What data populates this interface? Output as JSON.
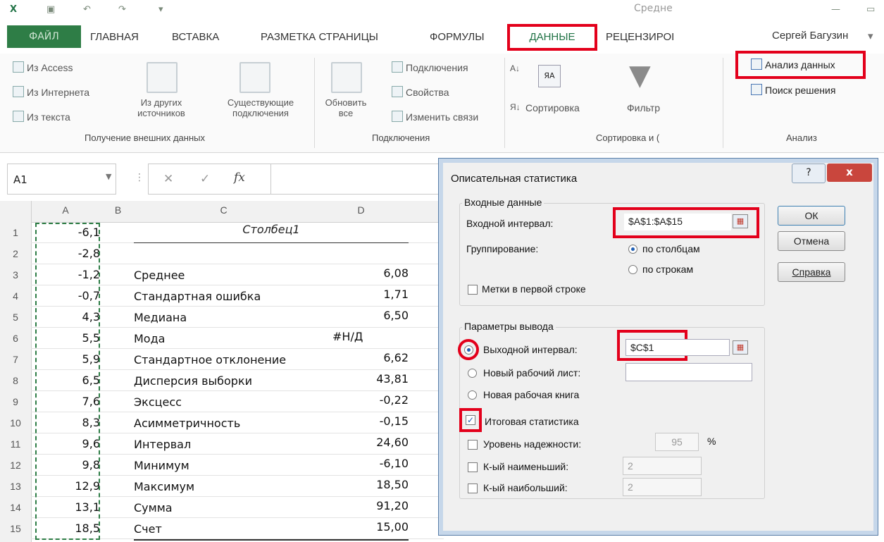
{
  "ribbon": {
    "tabs": [
      "ФАЙЛ",
      "ГЛАВНАЯ",
      "ВСТАВКА",
      "РАЗМЕТКА СТРАНИЦЫ",
      "ФОРМУЛЫ",
      "ДАННЫЕ",
      "РЕЦЕНЗИРОІ"
    ],
    "user": "Сергей Багузин",
    "title_fragment": "Средне",
    "ext_data": {
      "from_access": "Из Access",
      "from_web": "Из Интернета",
      "from_text": "Из текста",
      "other_sources_1": "Из других",
      "other_sources_2": "источников",
      "existing_1": "Существующие",
      "existing_2": "подключения",
      "group": "Получение внешних данных"
    },
    "connections": {
      "refresh_1": "Обновить",
      "refresh_2": "все",
      "connections": "Подключения",
      "properties": "Свойства",
      "edit_links": "Изменить связи",
      "group": "Подключения"
    },
    "sort": {
      "sort": "Сортировка",
      "filter": "Фильтр",
      "group": "Сортировка и ("
    },
    "analysis": {
      "data_analysis": "Анализ данных",
      "solver": "Поиск решения",
      "group": "Анализ"
    }
  },
  "formula_bar": {
    "name_box": "A1",
    "fx": "fx"
  },
  "sheet": {
    "col_headers": [
      "A",
      "B",
      "C",
      "D"
    ],
    "row_numbers": [
      "1",
      "2",
      "3",
      "4",
      "5",
      "6",
      "7",
      "8",
      "9",
      "10",
      "11",
      "12",
      "13",
      "14",
      "15"
    ],
    "colA": [
      "-6,1",
      "-2,8",
      "-1,2",
      "-0,7",
      "4,3",
      "5,5",
      "5,9",
      "6,5",
      "7,6",
      "8,3",
      "9,6",
      "9,8",
      "12,9",
      "13,1",
      "18,5"
    ],
    "header_c": "Столбец1",
    "stats": [
      {
        "label": "Среднее",
        "value": "6,08"
      },
      {
        "label": "Стандартная ошибка",
        "value": "1,71"
      },
      {
        "label": "Медиана",
        "value": "6,50"
      },
      {
        "label": "Мода",
        "value": "#Н/Д"
      },
      {
        "label": "Стандартное отклонение",
        "value": "6,62"
      },
      {
        "label": "Дисперсия выборки",
        "value": "43,81"
      },
      {
        "label": "Эксцесс",
        "value": "-0,22"
      },
      {
        "label": "Асимметричность",
        "value": "-0,15"
      },
      {
        "label": "Интервал",
        "value": "24,60"
      },
      {
        "label": "Минимум",
        "value": "-6,10"
      },
      {
        "label": "Максимум",
        "value": "18,50"
      },
      {
        "label": "Сумма",
        "value": "91,20"
      },
      {
        "label": "Счет",
        "value": "15,00"
      }
    ]
  },
  "dialog": {
    "title": "Описательная статистика",
    "help_glyph": "?",
    "close_glyph": "x",
    "input_group": "Входные данные",
    "input_range_label": "Входной интервал:",
    "input_range_value": "$A$1:$A$15",
    "grouping_label": "Группирование:",
    "by_columns": "по столбцам",
    "by_rows": "по строкам",
    "labels_first_row": "Метки в первой строке",
    "output_group": "Параметры вывода",
    "output_range_label": "Выходной интервал:",
    "output_range_value": "$C$1",
    "new_sheet": "Новый рабочий лист:",
    "new_book": "Новая рабочая книга",
    "summary_stats": "Итоговая статистика",
    "confidence_level": "Уровень надежности:",
    "confidence_value": "95",
    "percent": "%",
    "kth_smallest": "К-ый наименьший:",
    "kth_smallest_value": "2",
    "kth_largest": "К-ый наибольший:",
    "kth_largest_value": "2",
    "ok": "ОК",
    "cancel": "Отмена",
    "help": "Справка"
  }
}
